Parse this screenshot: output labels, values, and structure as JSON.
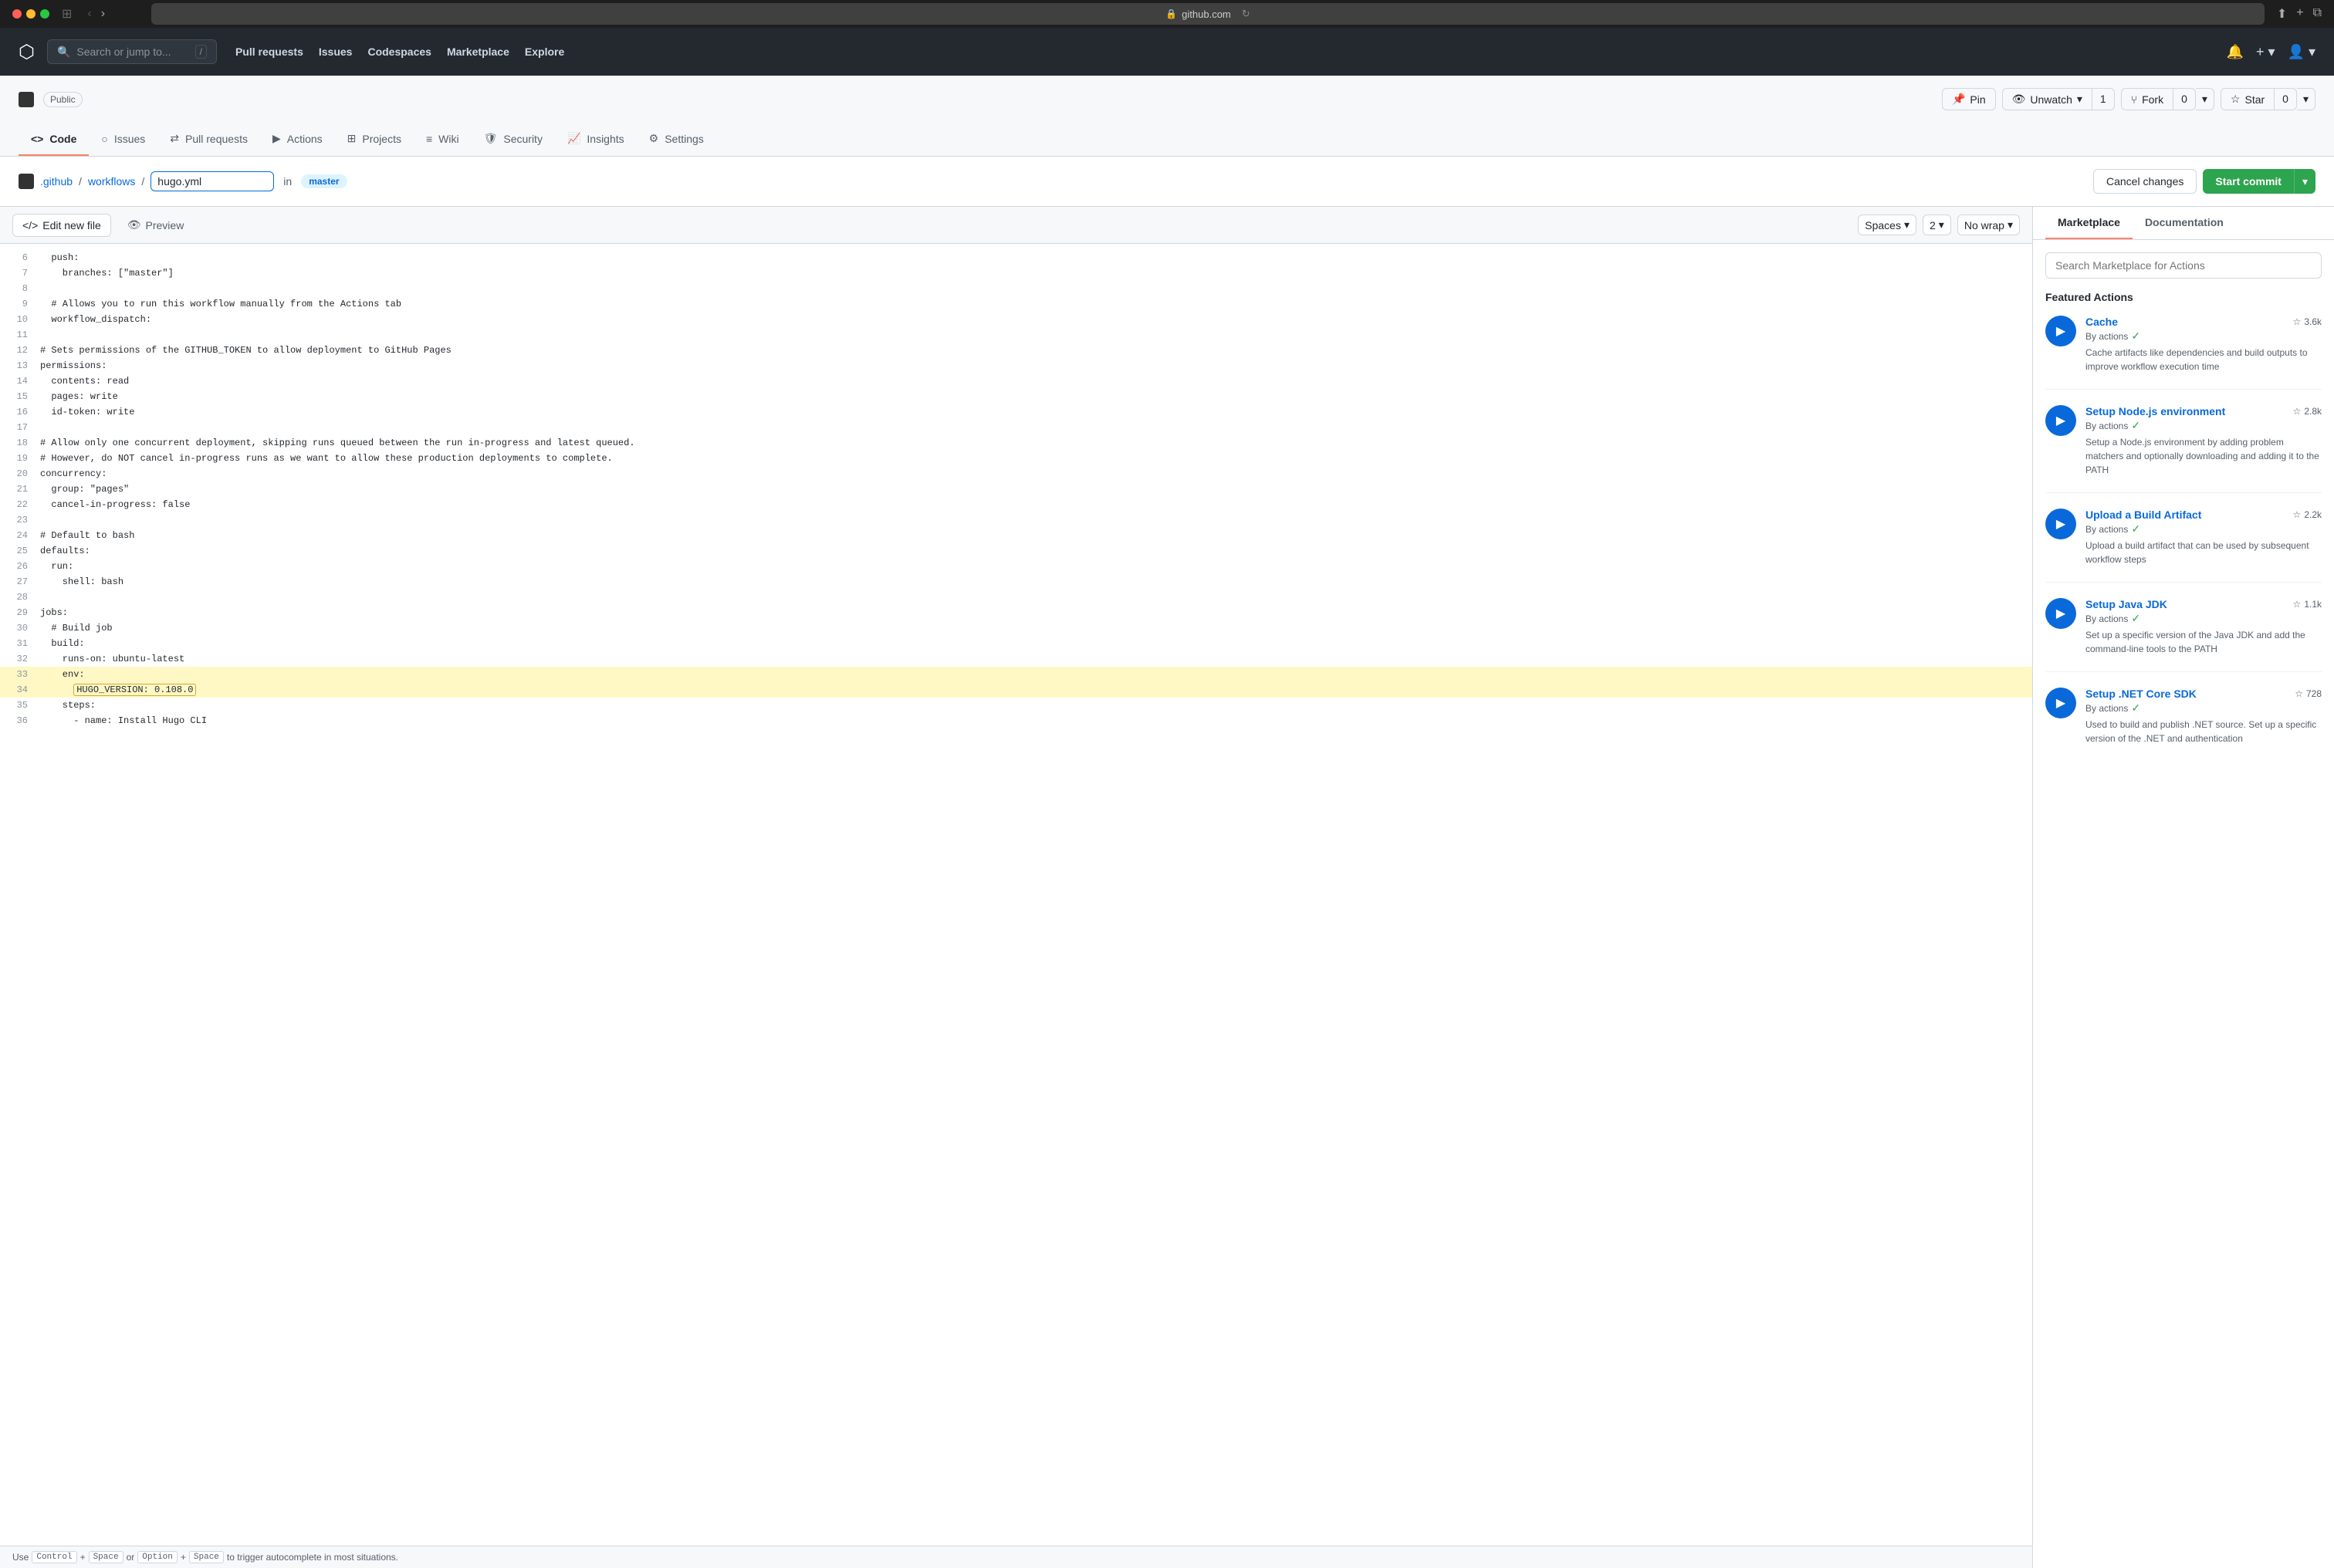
{
  "browser": {
    "url": "github.com",
    "lock_icon": "🔒"
  },
  "gh_header": {
    "search_placeholder": "Search or jump to...",
    "search_shortcut": "/",
    "nav_items": [
      "Pull requests",
      "Issues",
      "Codespaces",
      "Marketplace",
      "Explore"
    ]
  },
  "repo": {
    "name_hidden": true,
    "public_label": "Public",
    "pin_label": "Pin",
    "watch_label": "Unwatch",
    "watch_count": "1",
    "fork_label": "Fork",
    "fork_count": "0",
    "star_label": "Star",
    "star_count": "0"
  },
  "tabs": [
    {
      "label": "Code",
      "icon": "<>",
      "active": true
    },
    {
      "label": "Issues",
      "icon": "○",
      "active": false
    },
    {
      "label": "Pull requests",
      "icon": "⇄",
      "active": false
    },
    {
      "label": "Actions",
      "icon": "▶",
      "active": false
    },
    {
      "label": "Projects",
      "icon": "⊞",
      "active": false
    },
    {
      "label": "Wiki",
      "icon": "≡",
      "active": false
    },
    {
      "label": "Security",
      "icon": "🛡",
      "active": false
    },
    {
      "label": "Insights",
      "icon": "📈",
      "active": false
    },
    {
      "label": "Settings",
      "icon": "⚙",
      "active": false
    }
  ],
  "breadcrumb": {
    "part1": ".github",
    "part2": "workflows",
    "filename": "hugo.yml",
    "branch_label": "in",
    "branch": "master"
  },
  "buttons": {
    "cancel": "Cancel changes",
    "start_commit": "Start commit"
  },
  "editor": {
    "tab_edit": "Edit new file",
    "tab_preview": "Preview",
    "spaces_label": "Spaces",
    "indent_label": "2",
    "wrap_label": "No wrap"
  },
  "code_lines": [
    {
      "num": 6,
      "content": "  push:"
    },
    {
      "num": 7,
      "content": "    branches: [\"master\"]"
    },
    {
      "num": 8,
      "content": ""
    },
    {
      "num": 9,
      "content": "  # Allows you to run this workflow manually from the Actions tab"
    },
    {
      "num": 10,
      "content": "  workflow_dispatch:"
    },
    {
      "num": 11,
      "content": ""
    },
    {
      "num": 12,
      "content": "# Sets permissions of the GITHUB_TOKEN to allow deployment to GitHub Pages"
    },
    {
      "num": 13,
      "content": "permissions:"
    },
    {
      "num": 14,
      "content": "  contents: read"
    },
    {
      "num": 15,
      "content": "  pages: write"
    },
    {
      "num": 16,
      "content": "  id-token: write"
    },
    {
      "num": 17,
      "content": ""
    },
    {
      "num": 18,
      "content": "# Allow only one concurrent deployment, skipping runs queued between the run in-progress and latest queued."
    },
    {
      "num": 19,
      "content": "# However, do NOT cancel in-progress runs as we want to allow these production deployments to complete."
    },
    {
      "num": 20,
      "content": "concurrency:"
    },
    {
      "num": 21,
      "content": "  group: \"pages\""
    },
    {
      "num": 22,
      "content": "  cancel-in-progress: false"
    },
    {
      "num": 23,
      "content": ""
    },
    {
      "num": 24,
      "content": "# Default to bash"
    },
    {
      "num": 25,
      "content": "defaults:"
    },
    {
      "num": 26,
      "content": "  run:"
    },
    {
      "num": 27,
      "content": "    shell: bash"
    },
    {
      "num": 28,
      "content": ""
    },
    {
      "num": 29,
      "content": "jobs:"
    },
    {
      "num": 30,
      "content": "  # Build job"
    },
    {
      "num": 31,
      "content": "  build:"
    },
    {
      "num": 32,
      "content": "    runs-on: ubuntu-latest"
    },
    {
      "num": 33,
      "content": "    env:",
      "highlight": true
    },
    {
      "num": 34,
      "content": "      HUGO_VERSION: 0.108.0",
      "highlight": true,
      "box": true
    },
    {
      "num": 35,
      "content": "    steps:"
    },
    {
      "num": 36,
      "content": "      - name: Install Hugo CLI"
    }
  ],
  "editor_footer": {
    "text1": "Use",
    "key1": "Control",
    "plus1": "+",
    "key2": "Space",
    "or1": "or",
    "key3": "Option",
    "plus2": "+",
    "key4": "Space",
    "text2": "to trigger autocomplete in most situations."
  },
  "marketplace": {
    "tab_marketplace": "Marketplace",
    "tab_documentation": "Documentation",
    "search_placeholder": "Search Marketplace for Actions",
    "featured_title": "Featured Actions",
    "actions": [
      {
        "name": "Cache",
        "by": "By actions",
        "stars": "3.6k",
        "desc": "Cache artifacts like dependencies and build outputs to improve workflow execution time"
      },
      {
        "name": "Setup Node.js environment",
        "by": "By actions",
        "stars": "2.8k",
        "desc": "Setup a Node.js environment by adding problem matchers and optionally downloading and adding it to the PATH"
      },
      {
        "name": "Upload a Build Artifact",
        "by": "By actions",
        "stars": "2.2k",
        "desc": "Upload a build artifact that can be used by subsequent workflow steps"
      },
      {
        "name": "Setup Java JDK",
        "by": "By actions",
        "stars": "1.1k",
        "desc": "Set up a specific version of the Java JDK and add the command-line tools to the PATH"
      },
      {
        "name": "Setup .NET Core SDK",
        "by": "By actions",
        "stars": "728",
        "desc": "Used to build and publish .NET source. Set up a specific version of the .NET and authentication"
      }
    ]
  }
}
